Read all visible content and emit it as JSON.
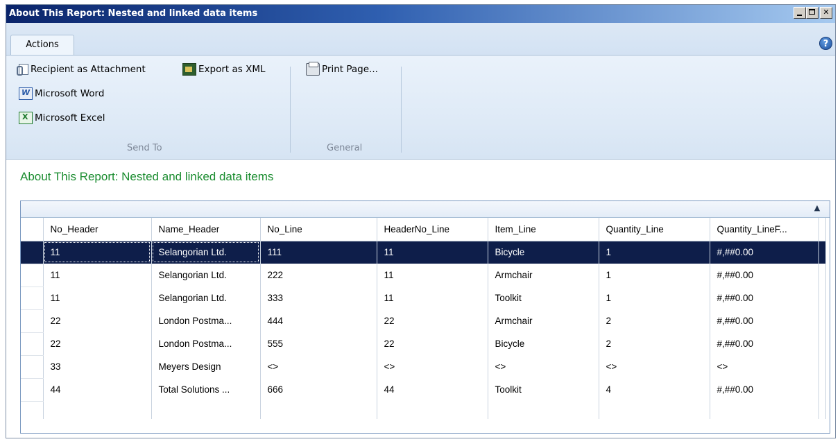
{
  "window": {
    "title": "About This Report: Nested and linked data items"
  },
  "ribbon": {
    "tab_label": "Actions",
    "send_to": {
      "recipient_as_attachment": "Recipient as Attachment",
      "microsoft_word": "Microsoft Word",
      "microsoft_excel": "Microsoft Excel",
      "export_as_xml": "Export as XML",
      "group_label": "Send To"
    },
    "general": {
      "print_page": "Print Page...",
      "group_label": "General"
    },
    "help": "?"
  },
  "report": {
    "heading": "About This Report: Nested and linked data items"
  },
  "grid": {
    "columns": [
      "No_Header",
      "Name_Header",
      "No_Line",
      "HeaderNo_Line",
      "Item_Line",
      "Quantity_Line",
      "Quantity_LineF..."
    ],
    "rows": [
      [
        "11",
        "Selangorian Ltd.",
        "111",
        "11",
        "Bicycle",
        "1",
        "#,##0.00"
      ],
      [
        "11",
        "Selangorian Ltd.",
        "222",
        "11",
        "Armchair",
        "1",
        "#,##0.00"
      ],
      [
        "11",
        "Selangorian Ltd.",
        "333",
        "11",
        "Toolkit",
        "1",
        "#,##0.00"
      ],
      [
        "22",
        "London Postma...",
        "444",
        "22",
        "Armchair",
        "2",
        "#,##0.00"
      ],
      [
        "22",
        "London Postma...",
        "555",
        "22",
        "Bicycle",
        "2",
        "#,##0.00"
      ],
      [
        "33",
        "Meyers Design",
        "<>",
        "<>",
        "<>",
        "<>",
        "<>"
      ],
      [
        "44",
        "Total Solutions ...",
        "666",
        "44",
        "Toolkit",
        "4",
        "#,##0.00"
      ]
    ],
    "selected_row": 0
  }
}
